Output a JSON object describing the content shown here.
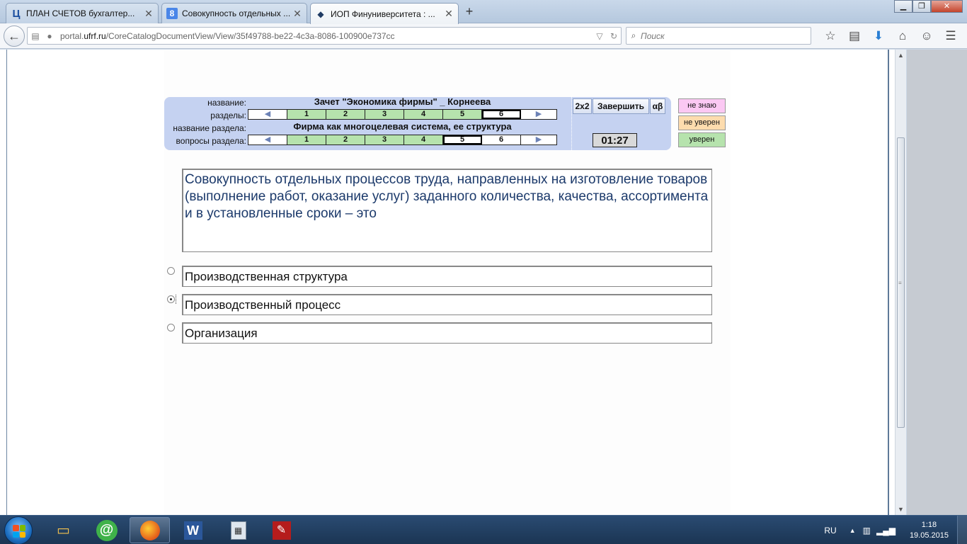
{
  "browser": {
    "tabs": [
      {
        "title": "ПЛАН СЧЕТОВ бухгалтер...",
        "favicon": "Ц",
        "favicon_color": "#1c4fa0"
      },
      {
        "title": "Совокупность отдельных ...",
        "favicon": "8",
        "favicon_color": "#ffffff"
      },
      {
        "title": "ИОП Финуниверситета : ...",
        "favicon": "◆",
        "favicon_color": "#1f3b63"
      }
    ],
    "url_prefix": "portal.",
    "url_domain": "ufrf.ru",
    "url_path": "/CoreCatalogDocumentView/View/35f49788-be22-4c3a-8086-100900e737cc",
    "search_placeholder": "Поиск",
    "icons": [
      "star-icon",
      "reading-list-icon",
      "download-icon",
      "home-icon",
      "smiley-icon",
      "menu-icon"
    ]
  },
  "test": {
    "name_label": "название:",
    "name_value": "Зачет \"Экономика фирмы\" _ Корнеева",
    "sections_label": "разделы:",
    "sections": [
      "1",
      "2",
      "3",
      "4",
      "5",
      "6"
    ],
    "section_name_label": "название раздела:",
    "section_name_value": "Фирма как многоцелевая система, ее структура",
    "questions_label": "вопросы раздела:",
    "questions": [
      "1",
      "2",
      "3",
      "4",
      "5",
      "6"
    ],
    "btn_2x2": "2x2",
    "btn_finish": "Завершить",
    "btn_alphabet": "αβ",
    "timer": "01:27"
  },
  "confidence": {
    "dont_know": "не знаю",
    "not_sure": "не уверен",
    "sure": "уверен",
    "colors": {
      "dont_know": "#fbc8f3",
      "not_sure": "#fddcae",
      "sure": "#b6e3ad"
    }
  },
  "question": {
    "text": "Совокупность отдельных процессов труда, направленных на изготовление товаров (выполнение работ, оказание услуг) заданного количества, качества, ассортимента и в установленные сроки – это",
    "answers": [
      {
        "text": "Производственная структура",
        "selected": false
      },
      {
        "text": "Производственный процесс",
        "selected": true
      },
      {
        "text": "Организация",
        "selected": false
      }
    ]
  },
  "taskbar": {
    "lang": "RU",
    "time": "1:18",
    "date": "19.05.2015"
  }
}
